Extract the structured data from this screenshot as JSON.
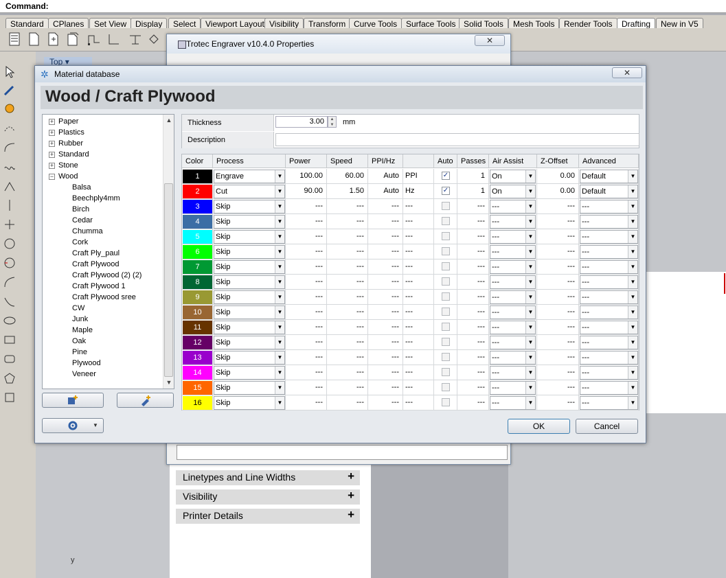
{
  "command": {
    "label": "Command:"
  },
  "tabs": [
    "Standard",
    "CPlanes",
    "Set View",
    "Display",
    "Select",
    "Viewport Layout",
    "Visibility",
    "Transform",
    "Curve Tools",
    "Surface Tools",
    "Solid Tools",
    "Mesh Tools",
    "Render Tools",
    "Drafting",
    "New in V5"
  ],
  "viewport": {
    "title": "Top",
    "axis_label": "y"
  },
  "print_panel": {
    "sections": [
      "Linetypes and Line Widths",
      "Visibility",
      "Printer Details"
    ]
  },
  "trotec_window": {
    "title": "Trotec Engraver v10.4.0 Properties",
    "close": "✕"
  },
  "material_db": {
    "title": "Material database",
    "close": "✕",
    "heading": "Wood / Craft Plywood",
    "tree": {
      "categories": [
        "Paper",
        "Plastics",
        "Rubber",
        "Standard",
        "Stone",
        "Wood"
      ],
      "wood_items": [
        "Balsa",
        "Beechply4mm",
        "Birch",
        "Cedar",
        "Chumma",
        "Cork",
        "Craft Ply_paul",
        "Craft Plywood",
        "Craft Plywood (2) (2)",
        "Craft Plywood 1",
        "Craft Plywood sree",
        "CW",
        "Junk",
        "Maple",
        "Oak",
        "Pine",
        "Plywood",
        "Veneer"
      ]
    },
    "thickness": {
      "label": "Thickness",
      "value": "3.00",
      "unit": "mm"
    },
    "description": {
      "label": "Description",
      "value": ""
    },
    "columns": [
      "Color",
      "Process",
      "Power",
      "Speed",
      "PPI/Hz",
      "",
      "Auto",
      "Passes",
      "Air Assist",
      "Z-Offset",
      "Advanced"
    ],
    "rows": [
      {
        "n": "1",
        "color": "#000000",
        "text_color": "#ffffff",
        "process": "Engrave",
        "power": "100.00",
        "speed": "60.00",
        "ppi": "Auto",
        "unit": "PPI",
        "auto": true,
        "passes": "1",
        "air": "On",
        "z": "0.00",
        "adv": "Default"
      },
      {
        "n": "2",
        "color": "#ff0000",
        "text_color": "#ffffff",
        "process": "Cut",
        "power": "90.00",
        "speed": "1.50",
        "ppi": "Auto",
        "unit": "Hz",
        "auto": true,
        "passes": "1",
        "air": "On",
        "z": "0.00",
        "adv": "Default"
      },
      {
        "n": "3",
        "color": "#0000ff",
        "text_color": "#ffffff",
        "process": "Skip",
        "power": "---",
        "speed": "---",
        "ppi": "---",
        "unit": "---",
        "auto": false,
        "passes": "---",
        "air": "---",
        "z": "---",
        "adv": "---"
      },
      {
        "n": "4",
        "color": "#3b6ea5",
        "text_color": "#ffffff",
        "process": "Skip",
        "power": "---",
        "speed": "---",
        "ppi": "---",
        "unit": "---",
        "auto": false,
        "passes": "---",
        "air": "---",
        "z": "---",
        "adv": "---"
      },
      {
        "n": "5",
        "color": "#00ffff",
        "text_color": "#ffffff",
        "process": "Skip",
        "power": "---",
        "speed": "---",
        "ppi": "---",
        "unit": "---",
        "auto": false,
        "passes": "---",
        "air": "---",
        "z": "---",
        "adv": "---"
      },
      {
        "n": "6",
        "color": "#00ff00",
        "text_color": "#ffffff",
        "process": "Skip",
        "power": "---",
        "speed": "---",
        "ppi": "---",
        "unit": "---",
        "auto": false,
        "passes": "---",
        "air": "---",
        "z": "---",
        "adv": "---"
      },
      {
        "n": "7",
        "color": "#009933",
        "text_color": "#ffffff",
        "process": "Skip",
        "power": "---",
        "speed": "---",
        "ppi": "---",
        "unit": "---",
        "auto": false,
        "passes": "---",
        "air": "---",
        "z": "---",
        "adv": "---"
      },
      {
        "n": "8",
        "color": "#006633",
        "text_color": "#ffffff",
        "process": "Skip",
        "power": "---",
        "speed": "---",
        "ppi": "---",
        "unit": "---",
        "auto": false,
        "passes": "---",
        "air": "---",
        "z": "---",
        "adv": "---"
      },
      {
        "n": "9",
        "color": "#999933",
        "text_color": "#ffffff",
        "process": "Skip",
        "power": "---",
        "speed": "---",
        "ppi": "---",
        "unit": "---",
        "auto": false,
        "passes": "---",
        "air": "---",
        "z": "---",
        "adv": "---"
      },
      {
        "n": "10",
        "color": "#996633",
        "text_color": "#ffffff",
        "process": "Skip",
        "power": "---",
        "speed": "---",
        "ppi": "---",
        "unit": "---",
        "auto": false,
        "passes": "---",
        "air": "---",
        "z": "---",
        "adv": "---"
      },
      {
        "n": "11",
        "color": "#663300",
        "text_color": "#ffffff",
        "process": "Skip",
        "power": "---",
        "speed": "---",
        "ppi": "---",
        "unit": "---",
        "auto": false,
        "passes": "---",
        "air": "---",
        "z": "---",
        "adv": "---"
      },
      {
        "n": "12",
        "color": "#660066",
        "text_color": "#ffffff",
        "process": "Skip",
        "power": "---",
        "speed": "---",
        "ppi": "---",
        "unit": "---",
        "auto": false,
        "passes": "---",
        "air": "---",
        "z": "---",
        "adv": "---"
      },
      {
        "n": "13",
        "color": "#9900cc",
        "text_color": "#ffffff",
        "process": "Skip",
        "power": "---",
        "speed": "---",
        "ppi": "---",
        "unit": "---",
        "auto": false,
        "passes": "---",
        "air": "---",
        "z": "---",
        "adv": "---"
      },
      {
        "n": "14",
        "color": "#ff00ff",
        "text_color": "#ffffff",
        "process": "Skip",
        "power": "---",
        "speed": "---",
        "ppi": "---",
        "unit": "---",
        "auto": false,
        "passes": "---",
        "air": "---",
        "z": "---",
        "adv": "---"
      },
      {
        "n": "15",
        "color": "#ff6600",
        "text_color": "#ffffff",
        "process": "Skip",
        "power": "---",
        "speed": "---",
        "ppi": "---",
        "unit": "---",
        "auto": false,
        "passes": "---",
        "air": "---",
        "z": "---",
        "adv": "---"
      },
      {
        "n": "16",
        "color": "#ffff00",
        "text_color": "#000000",
        "process": "Skip",
        "power": "---",
        "speed": "---",
        "ppi": "---",
        "unit": "---",
        "auto": false,
        "passes": "---",
        "air": "---",
        "z": "---",
        "adv": "---"
      }
    ],
    "buttons": {
      "ok": "OK",
      "cancel": "Cancel"
    }
  }
}
